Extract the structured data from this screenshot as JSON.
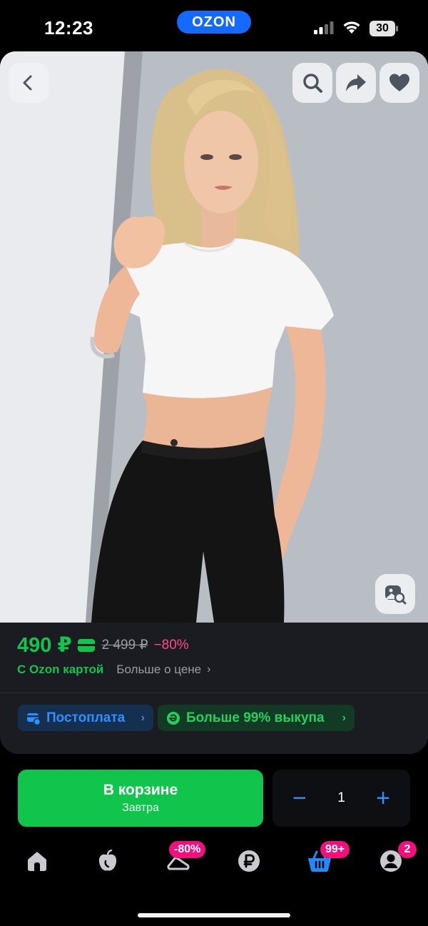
{
  "status_bar": {
    "time": "12:23",
    "app_pill": "OZON",
    "battery": "30",
    "icons": [
      "signal-icon",
      "wifi-icon",
      "battery-icon"
    ]
  },
  "photo": {
    "buttons": [
      "back-icon",
      "search-icon",
      "share-icon",
      "heart-icon",
      "similar-search-icon"
    ]
  },
  "price": {
    "current": "490 ₽",
    "old": "2 499 ₽",
    "discount": "−80%",
    "ozon_card": "С Ozon картой",
    "more": "Больше о цене",
    "chevron": "›"
  },
  "chips": {
    "postpay": "Постоплата",
    "buyout": "Больше 99% выкупа",
    "chevron": "›"
  },
  "cart": {
    "title": "В корзине",
    "subtitle": "Завтра",
    "quantity": "1",
    "minus": "−",
    "plus": "+"
  },
  "tabbar": {
    "items": [
      "home-icon",
      "fresh-icon",
      "sale-icon",
      "ruble-icon",
      "cart-icon",
      "profile-icon"
    ],
    "sale_badge": "-80%",
    "cart_badge": "99+",
    "profile_badge": "2"
  },
  "colors": {
    "accent_green": "#10c44c",
    "accent_blue": "#2e8fff",
    "badge_pink": "#f1117e",
    "discount_pink": "#ff4a8d",
    "brand_blue": "#1469ff"
  }
}
